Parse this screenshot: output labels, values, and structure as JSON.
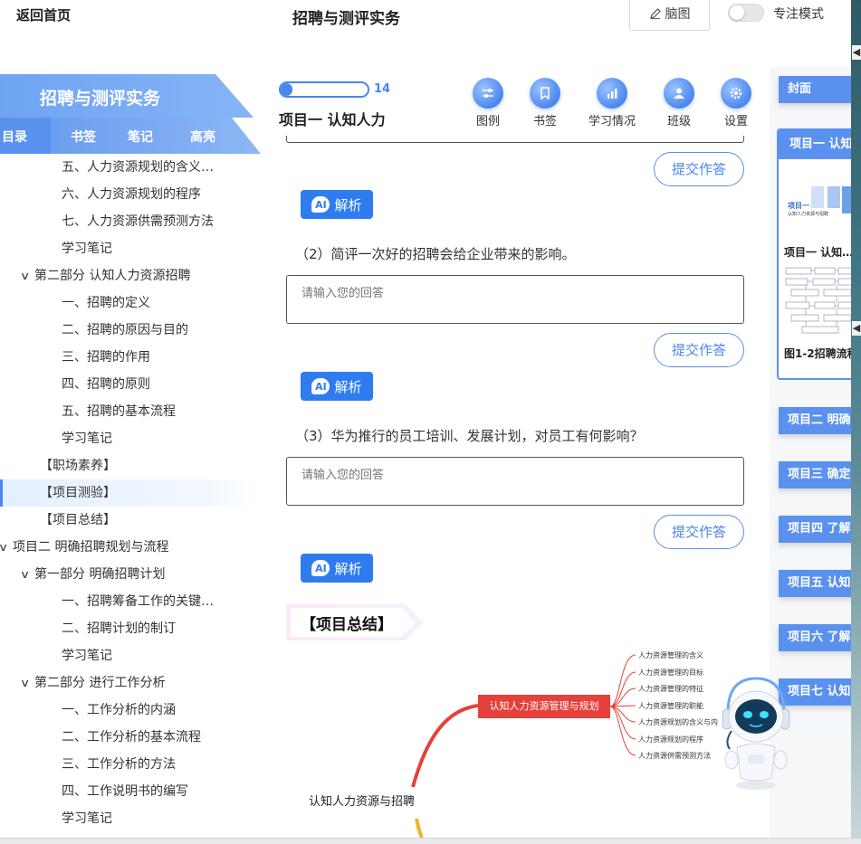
{
  "header": {
    "back_home": "返回首页",
    "title": "招聘与测评实务",
    "mindmap_label": "脑图",
    "focus_mode_label": "专注模式",
    "focus_mode_on": false
  },
  "sidebar": {
    "book_title": "招聘与测评实务",
    "tabs": [
      "目录",
      "书签",
      "笔记",
      "高亮"
    ],
    "toc": [
      {
        "label": "五、人力资源规划的含义…",
        "level": 2
      },
      {
        "label": "六、人力资源规划的程序",
        "level": 2
      },
      {
        "label": "七、人力资源供需预测方法",
        "level": 2
      },
      {
        "label": "学习笔记",
        "level": 2
      },
      {
        "label": "第二部分 认知人力资源招聘",
        "level": 1,
        "expanded": true
      },
      {
        "label": "一、招聘的定义",
        "level": 2
      },
      {
        "label": "二、招聘的原因与目的",
        "level": 2
      },
      {
        "label": "三、招聘的作用",
        "level": 2
      },
      {
        "label": "四、招聘的原则",
        "level": 2
      },
      {
        "label": "五、招聘的基本流程",
        "level": 2
      },
      {
        "label": "学习笔记",
        "level": 2
      },
      {
        "label": "【职场素养】",
        "level": 1
      },
      {
        "label": "【项目测验】",
        "level": 1,
        "active": true
      },
      {
        "label": "【项目总结】",
        "level": 1
      },
      {
        "label": "项目二 明确招聘规划与流程",
        "level": 0,
        "expanded": true
      },
      {
        "label": "第一部分 明确招聘计划",
        "level": 1,
        "expanded": true
      },
      {
        "label": "一、招聘筹备工作的关键…",
        "level": 2
      },
      {
        "label": "二、招聘计划的制订",
        "level": 2
      },
      {
        "label": "学习笔记",
        "level": 2
      },
      {
        "label": "第二部分 进行工作分析",
        "level": 1,
        "expanded": true
      },
      {
        "label": "一、工作分析的内涵",
        "level": 2
      },
      {
        "label": "二、工作分析的基本流程",
        "level": 2
      },
      {
        "label": "三、工作分析的方法",
        "level": 2
      },
      {
        "label": "四、工作说明书的编写",
        "level": 2
      },
      {
        "label": "学习笔记",
        "level": 2
      }
    ]
  },
  "toolbar": {
    "progress_value": 14,
    "progress_fraction": 0.14,
    "chapter_name": "项目一 认知人力",
    "tools": [
      {
        "label": "图例",
        "icon": "sliders-icon"
      },
      {
        "label": "书签",
        "icon": "bookmark-icon"
      },
      {
        "label": "学习情况",
        "icon": "chart-icon"
      },
      {
        "label": "班级",
        "icon": "users-icon"
      },
      {
        "label": "设置",
        "icon": "gear-icon"
      }
    ]
  },
  "content": {
    "submit_label": "提交作答",
    "ai_badge": "AI",
    "ai_label": "解析",
    "answer_placeholder": "请输入您的回答",
    "questions": [
      "（2）简评一次好的招聘会给企业带来的影响。",
      "（3）华为推行的员工培训、发展计划，对员工有何影响？"
    ],
    "summary_title": "【项目总结】",
    "mindmap": {
      "root": "认知人力资源与招聘",
      "node": "认知人力资源管理与规划",
      "leaves": [
        "人力资源管理的含义",
        "人力资源管理的目标",
        "人力资源管理的特征",
        "人力资源管理的职能",
        "人力资源规划的含义与内",
        "人力资源规划的程序",
        "人力资源供需预测方法"
      ]
    }
  },
  "rail": {
    "cover": "封面",
    "current_head": "项目一 认知",
    "thumb_caption_1": "项目一 认知…",
    "thumb_caption_2": "图1-2招聘流程",
    "thumb_banner_small": "项目一",
    "thumb_banner_sub": "认知人力资源与招聘",
    "chapters": [
      "项目二 明确",
      "项目三 确定",
      "项目四 了解",
      "项目五 认知",
      "项目六 了解",
      "项目七 认知"
    ]
  },
  "colors": {
    "accent": "#4a86ee",
    "ai_button": "#2f7cf0",
    "mindmap_node": "#e5413a"
  }
}
